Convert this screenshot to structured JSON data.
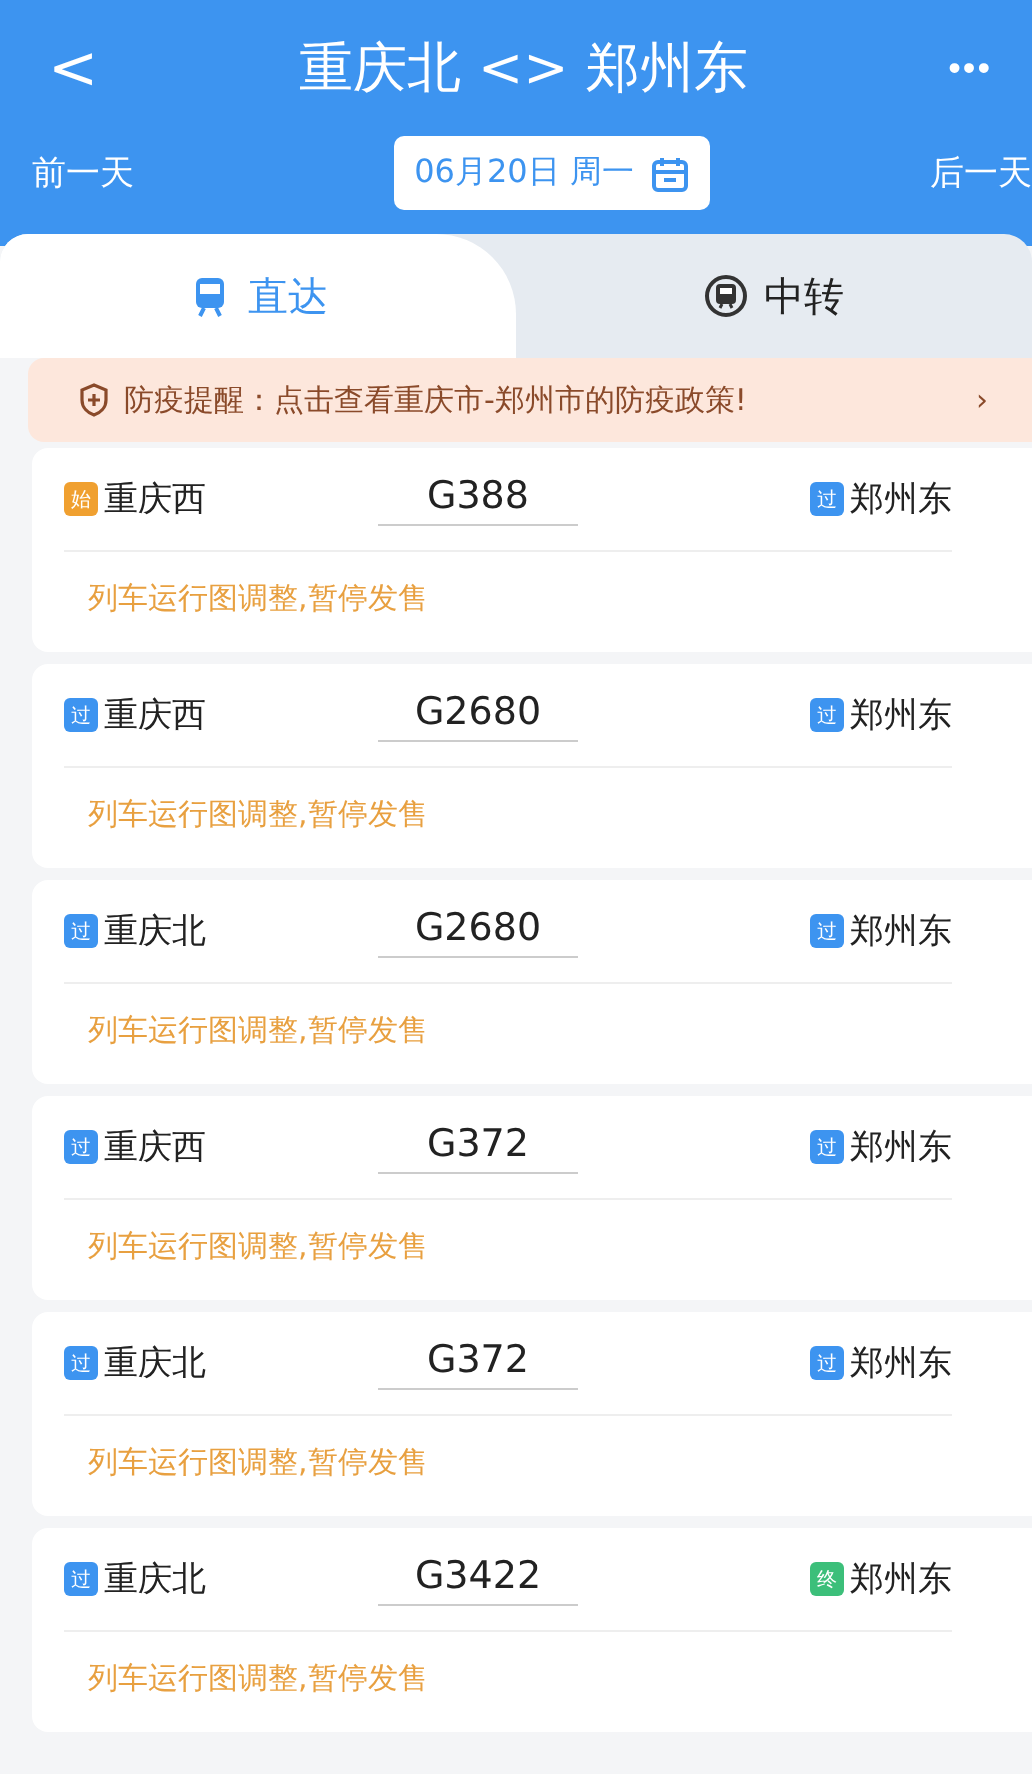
{
  "header": {
    "back": "<",
    "title": "重庆北 <> 郑州东",
    "more": "•••"
  },
  "date_bar": {
    "prev": "前一天",
    "date": "06月20日 周一",
    "next": "后一天"
  },
  "tabs": [
    {
      "label": "直达",
      "selected": true
    },
    {
      "label": "中转",
      "selected": false
    }
  ],
  "notice": {
    "text": "防疫提醒：点击查看重庆市-郑州市的防疫政策!",
    "arrow": "›"
  },
  "trains": [
    {
      "from": {
        "badge": "始",
        "color": "#f0a030",
        "name": "重庆西"
      },
      "number": "G388",
      "to": {
        "badge": "过",
        "color": "#3d94f0",
        "name": "郑州东"
      },
      "status": "列车运行图调整,暂停发售"
    },
    {
      "from": {
        "badge": "过",
        "color": "#3d94f0",
        "name": "重庆西"
      },
      "number": "G2680",
      "to": {
        "badge": "过",
        "color": "#3d94f0",
        "name": "郑州东"
      },
      "status": "列车运行图调整,暂停发售"
    },
    {
      "from": {
        "badge": "过",
        "color": "#3d94f0",
        "name": "重庆北"
      },
      "number": "G2680",
      "to": {
        "badge": "过",
        "color": "#3d94f0",
        "name": "郑州东"
      },
      "status": "列车运行图调整,暂停发售"
    },
    {
      "from": {
        "badge": "过",
        "color": "#3d94f0",
        "name": "重庆西"
      },
      "number": "G372",
      "to": {
        "badge": "过",
        "color": "#3d94f0",
        "name": "郑州东"
      },
      "status": "列车运行图调整,暂停发售"
    },
    {
      "from": {
        "badge": "过",
        "color": "#3d94f0",
        "name": "重庆北"
      },
      "number": "G372",
      "to": {
        "badge": "过",
        "color": "#3d94f0",
        "name": "郑州东"
      },
      "status": "列车运行图调整,暂停发售"
    },
    {
      "from": {
        "badge": "过",
        "color": "#3d94f0",
        "name": "重庆北"
      },
      "number": "G3422",
      "to": {
        "badge": "终",
        "color": "#3cbf7a",
        "name": "郑州东"
      },
      "status": "列车运行图调整,暂停发售"
    }
  ]
}
